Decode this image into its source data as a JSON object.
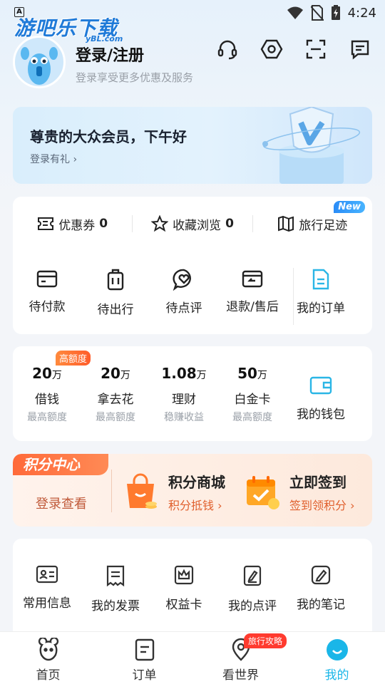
{
  "statusbar": {
    "time": "4:24",
    "left_icon": "A"
  },
  "watermark": {
    "text": "游吧乐下载",
    "sub": "yBL.com"
  },
  "profile": {
    "title": "登录/注册",
    "subtitle": "登录享受更多优惠及服务"
  },
  "top_icons": [
    "headset-icon",
    "settings-hexagon-icon",
    "scan-icon",
    "message-icon"
  ],
  "member": {
    "title": "尊贵的大众会员，下午好",
    "link": "登录有礼",
    "badge_letter": "V"
  },
  "stats": {
    "coupon_label": "优惠券",
    "coupon_count": "0",
    "fav_label": "收藏浏览",
    "fav_count": "0",
    "footprint_label": "旅行足迹",
    "new_badge": "New"
  },
  "orders": [
    {
      "label": "待付款"
    },
    {
      "label": "待出行"
    },
    {
      "label": "待点评"
    },
    {
      "label": "退款/售后"
    },
    {
      "label": "我的订单"
    }
  ],
  "wallet": {
    "hot_badge": "高额度",
    "items": [
      {
        "value": "20",
        "unit": "万",
        "name": "借钱",
        "note": "最高额度"
      },
      {
        "value": "20",
        "unit": "万",
        "name": "拿去花",
        "note": "最高额度"
      },
      {
        "value": "1.08",
        "unit": "万",
        "name": "理财",
        "note": "稳赚收益"
      },
      {
        "value": "50",
        "unit": "万",
        "name": "白金卡",
        "note": "最高额度"
      }
    ],
    "entry": "我的钱包"
  },
  "points": {
    "tag": "积分中心",
    "login": "登录查看",
    "mall_title": "积分商城",
    "mall_sub": "积分抵钱",
    "sign_title": "立即签到",
    "sign_sub": "签到领积分"
  },
  "tools": [
    {
      "label": "常用信息"
    },
    {
      "label": "我的发票"
    },
    {
      "label": "权益卡"
    },
    {
      "label": "我的点评"
    },
    {
      "label": "我的笔记"
    }
  ],
  "nav": {
    "home": "首页",
    "orders": "订单",
    "world": "看世界",
    "world_badge": "旅行攻略",
    "me": "我的",
    "active_color": "#1ab6e8"
  }
}
